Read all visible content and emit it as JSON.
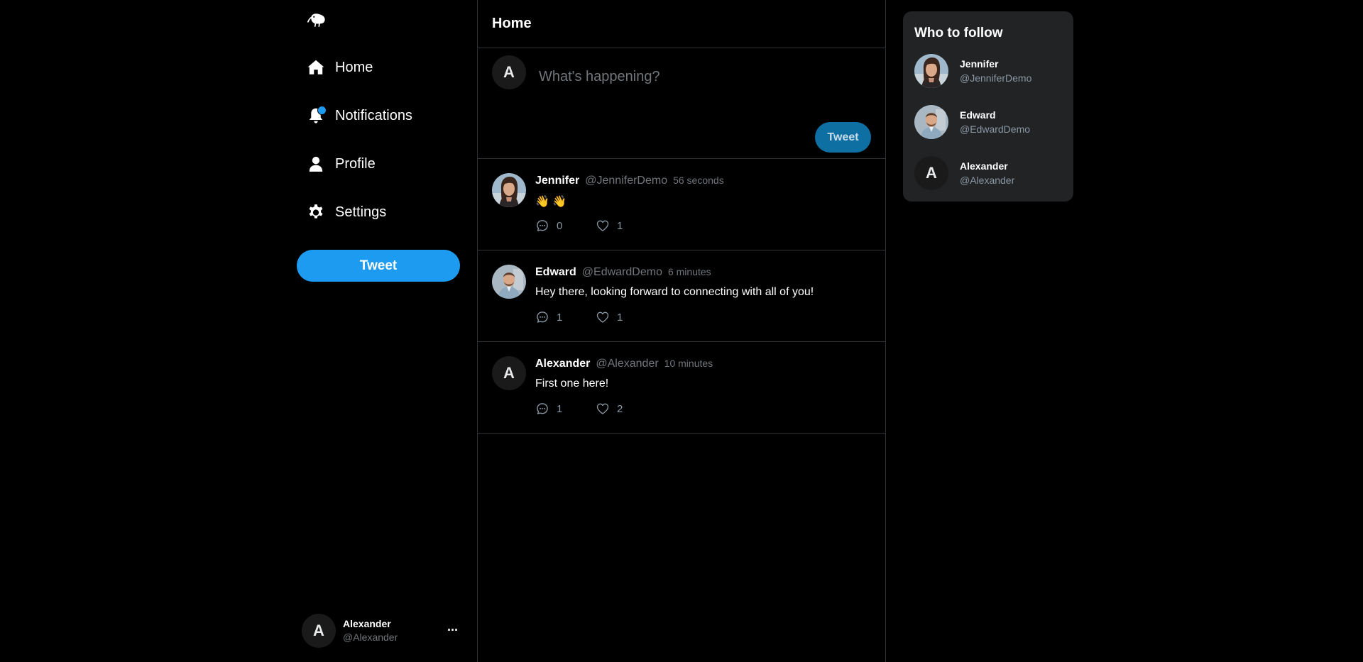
{
  "sidebar": {
    "logo_icon": "kiwi-bird-icon",
    "items": [
      {
        "label": "Home",
        "icon": "home-icon"
      },
      {
        "label": "Notifications",
        "icon": "bell-icon"
      },
      {
        "label": "Profile",
        "icon": "user-icon"
      },
      {
        "label": "Settings",
        "icon": "gear-icon"
      }
    ],
    "tweet_button": "Tweet",
    "account": {
      "avatar_letter": "A",
      "name": "Alexander",
      "handle": "@Alexander",
      "more_label": "···"
    }
  },
  "main": {
    "title": "Home",
    "composer": {
      "avatar_letter": "A",
      "placeholder": "What's happening?",
      "button": "Tweet"
    },
    "tweets": [
      {
        "name": "Jennifer",
        "handle": "@JenniferDemo",
        "time": "56 seconds",
        "text": "👋 👋",
        "replies": "0",
        "likes": "1",
        "avatar": "photo-jennifer"
      },
      {
        "name": "Edward",
        "handle": "@EdwardDemo",
        "time": "6 minutes",
        "text": "Hey there, looking forward to connecting with all of you!",
        "replies": "1",
        "likes": "1",
        "avatar": "photo-edward"
      },
      {
        "name": "Alexander",
        "handle": "@Alexander",
        "time": "10 minutes",
        "text": "First one here!",
        "replies": "1",
        "likes": "2",
        "avatar_letter": "A"
      }
    ]
  },
  "who_to_follow": {
    "title": "Who to follow",
    "users": [
      {
        "name": "Jennifer",
        "handle": "@JenniferDemo",
        "avatar": "photo-jennifer"
      },
      {
        "name": "Edward",
        "handle": "@EdwardDemo",
        "avatar": "photo-edward"
      },
      {
        "name": "Alexander",
        "handle": "@Alexander",
        "avatar_letter": "A"
      }
    ]
  },
  "colors": {
    "accent": "#1d9bf0",
    "background": "#000000",
    "panel": "#222325",
    "border": "#2f3336",
    "muted_text": "#71767b"
  }
}
